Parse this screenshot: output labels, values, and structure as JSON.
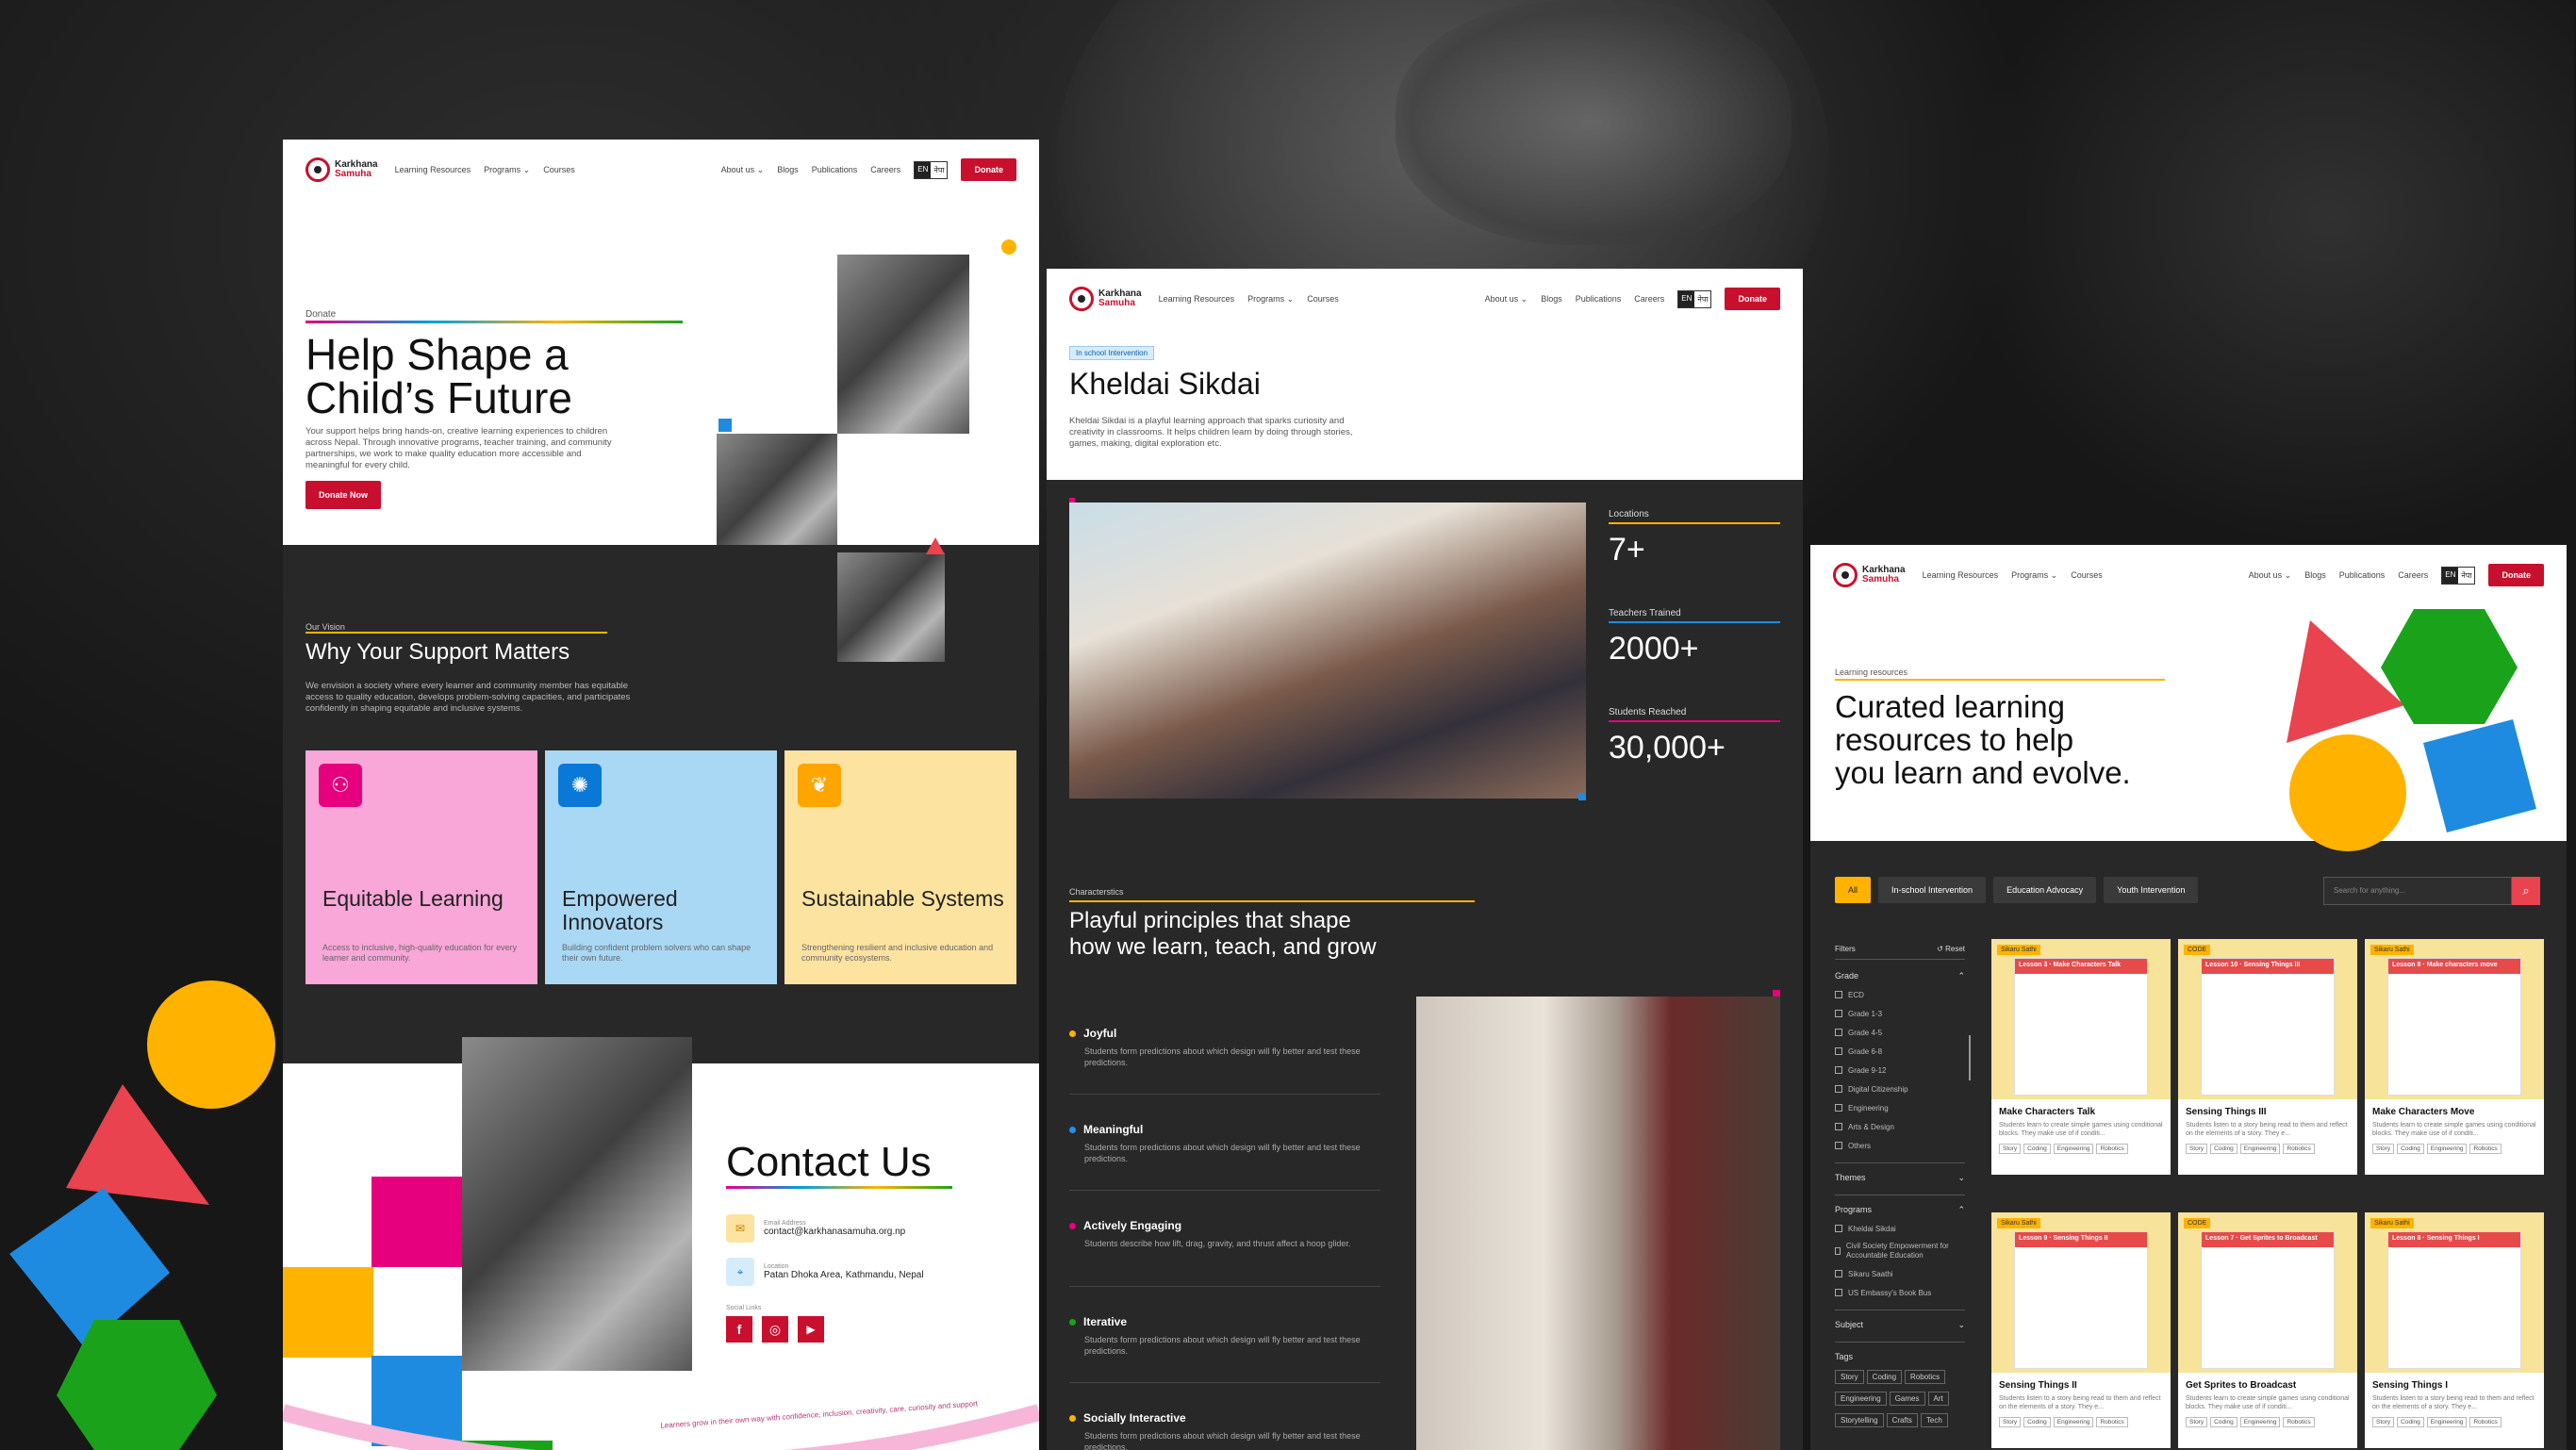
{
  "nav": {
    "logo_line1": "Karkhana",
    "logo_line2": "Samuha",
    "learning_resources": "Learning Resources",
    "programs": "Programs ⌄",
    "courses": "Courses",
    "about": "About us ⌄",
    "blogs": "Blogs",
    "publications": "Publications",
    "careers": "Careers",
    "lang_en": "EN",
    "lang_np": "नेपा",
    "donate": "Donate"
  },
  "donate_page": {
    "eyebrow": "Donate",
    "title_line1": "Help Shape a",
    "title_line2": "Child’s Future",
    "intro": "Your support helps bring hands-on, creative learning experiences to children across Nepal. Through innovative programs, teacher training, and community partnerships, we work to make quality education more accessible and meaningful for every child.",
    "cta": "Donate Now",
    "vision_eyebrow": "Our Vision",
    "vision_title": "Why Your Support Matters",
    "vision_text": "We envision a society where every learner and community member has equitable access to quality education, develops problem-solving capacities, and participates confidently in shaping equitable and inclusive systems.",
    "cards": [
      {
        "title": "Equitable Learning",
        "text": "Access to inclusive, high-quality education for every learner and community.",
        "color": "#f9a6d8",
        "icon_bg": "#e6007e",
        "icon": "people-icon"
      },
      {
        "title": "Empowered Innovators",
        "text": "Building confident problem solvers who can shape their own future.",
        "color": "#a9d8f5",
        "icon_bg": "#0a78d6",
        "icon": "lightbulb-icon"
      },
      {
        "title": "Sustainable Systems",
        "text": "Strengthening resilient and inclusive education and community ecosystems.",
        "color": "#fde3a0",
        "icon_bg": "#ffa500",
        "icon": "leaf-icon"
      }
    ],
    "contact_title": "Contact Us",
    "email_label": "Email Address",
    "email": "contact@karkhanasamuha.org.np",
    "location_label": "Location",
    "location": "Patan Dhoka Area, Kathmandu, Nepal",
    "social_label": "Social Links",
    "ribbon": "Learners grow in their own way with confidence, inclusion, creativity, care, curiosity and support"
  },
  "program_page": {
    "badge": "In school Intervention",
    "title": "Kheldai Sikdai",
    "intro": "Kheldai Sikdai is a playful learning approach that sparks curiosity and creativity in classrooms. It helps children learn by doing through stories, games, making, digital exploration etc.",
    "stats": [
      {
        "label": "Locations",
        "value": "7+"
      },
      {
        "label": "Teachers Trained",
        "value": "2000+"
      },
      {
        "label": "Students Reached",
        "value": "30,000+"
      }
    ],
    "char_eyebrow": "Characterstics",
    "char_title_line1": "Playful principles that shape",
    "char_title_line2": "how we learn, teach, and grow",
    "principles": [
      {
        "title": "Joyful",
        "text": "Students form predictions about which design will fly better and test these predictions.",
        "color": "#ffb300"
      },
      {
        "title": "Meaningful",
        "text": "Students form predictions about which design will fly better and test these predictions.",
        "color": "#1e90ff"
      },
      {
        "title": "Actively Engaging",
        "text": "Students describe how lift, drag, gravity, and thrust affect a hoop glider.",
        "color": "#e6007e"
      },
      {
        "title": "Iterative",
        "text": "Students form predictions about which design will fly better and test these predictions.",
        "color": "#1aa31a"
      },
      {
        "title": "Socially Interactive",
        "text": "Students form predictions about which design will fly better and test these predictions.",
        "color": "#ffb300"
      }
    ]
  },
  "resources_page": {
    "eyebrow": "Learning resources",
    "title_line1": "Curated learning",
    "title_line2": "resources to help",
    "title_line3": "you learn and evolve.",
    "chips": [
      "All",
      "In-school Intervention",
      "Education Advocacy",
      "Youth Intervention"
    ],
    "search_placeholder": "Search for anything...",
    "filters_label": "Filters",
    "reset": "↺ Reset",
    "grade_label": "Grade",
    "grades": [
      "ECD",
      "Grade 1-3",
      "Grade 4-5",
      "Grade 6-8",
      "Grade 9-12",
      "Digital Citizenship",
      "Engineering",
      "Arts & Design",
      "Others"
    ],
    "themes_label": "Themes",
    "programs_label": "Programs",
    "programs": [
      "Kheldai Sikdai",
      "Civil Society Empowerment for Accountable Education",
      "Sikaru Saathi",
      "US Embassy's Book Bus"
    ],
    "subject_label": "Subject",
    "tags_label": "Tags",
    "tags": [
      "Story",
      "Coding",
      "Robotics",
      "Engineering",
      "Games",
      "Art",
      "Storytelling",
      "Crafts",
      "Tech"
    ],
    "cards": [
      {
        "badge": "Sikaru Sathi",
        "lesson": "Lesson 3",
        "sheet": "Make Characters Talk",
        "title": "Make Characters Talk",
        "text": "Students learn to create simple games using conditional blocks. They make use of if conditi...",
        "tags": [
          "Story",
          "Coding",
          "Engineering",
          "Robotics"
        ]
      },
      {
        "badge": "CODE",
        "lesson": "Lesson 10",
        "sheet": "Sensing Things III",
        "title": "Sensing Things III",
        "text": "Students listen to a story being read to them and reflect on the elements of a story. They e...",
        "tags": [
          "Story",
          "Coding",
          "Engineering",
          "Robotics"
        ]
      },
      {
        "badge": "Sikaru Sathi",
        "lesson": "Lesson 8",
        "sheet": "Make characters move",
        "title": "Make Characters Move",
        "text": "Students learn to create simple games using conditional blocks. They make use of if conditi...",
        "tags": [
          "Story",
          "Coding",
          "Engineering",
          "Robotics"
        ]
      },
      {
        "badge": "Sikaru Sathi",
        "lesson": "Lesson 9",
        "sheet": "Sensing Things II",
        "title": "Sensing Things II",
        "text": "Students listen to a story being read to them and reflect on the elements of a story. They e...",
        "tags": [
          "Story",
          "Coding",
          "Engineering",
          "Robotics"
        ]
      },
      {
        "badge": "CODE",
        "lesson": "Lesson 7",
        "sheet": "Get Sprites to Broadcast",
        "title": "Get Sprites to Broadcast",
        "text": "Students learn to create simple games using conditional blocks. They make use of if conditi...",
        "tags": [
          "Story",
          "Coding",
          "Engineering",
          "Robotics"
        ]
      },
      {
        "badge": "Sikaru Sathi",
        "lesson": "Lesson 8",
        "sheet": "Sensing Things I",
        "title": "Sensing Things I",
        "text": "Students listen to a story being read to them and reflect on the elements of a story. They e...",
        "tags": [
          "Story",
          "Coding",
          "Engineering",
          "Robotics"
        ]
      }
    ]
  }
}
